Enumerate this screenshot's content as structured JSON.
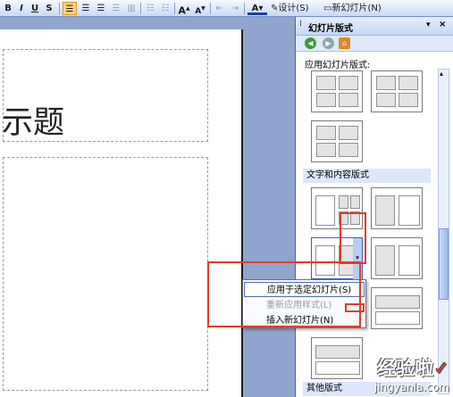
{
  "toolbar": {
    "bold": "B",
    "italic": "I",
    "underline": "U",
    "shadow": "S",
    "font_grow": "A",
    "font_shrink": "A",
    "design_label": "设计(S)",
    "new_slide_label": "新幻灯片(N)"
  },
  "slide": {
    "title": "示题"
  },
  "task_pane": {
    "title": "幻灯片版式",
    "apply_label": "应用幻灯片版式:",
    "section_text_content": "文字和内容版式",
    "section_other": "其他版式"
  },
  "context_menu": {
    "items": [
      {
        "label": "应用于选定幻灯片(S)"
      },
      {
        "label": "重新应用样式(L)"
      },
      {
        "label": "插入新幻灯片(N)"
      }
    ]
  },
  "watermark": {
    "main": "经验啦",
    "check": "✓",
    "url": "jingyanla.com"
  },
  "colors": {
    "accent": "#ffd27a",
    "highlight_box": "#e53a2a"
  }
}
